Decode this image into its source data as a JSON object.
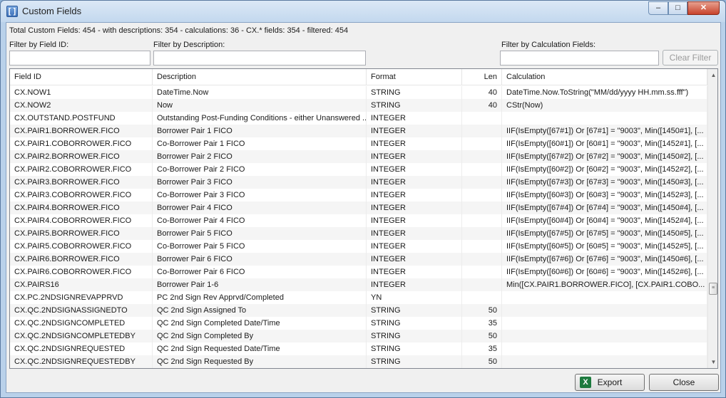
{
  "window": {
    "title": "Custom Fields",
    "app_icon_glyph": "[ ]",
    "minimize": "–",
    "maximize": "□",
    "close": "✕"
  },
  "summary": "Total Custom Fields: 454  -  with descriptions: 354  -  calculations: 36  -  CX.* fields: 354  -  filtered: 454",
  "filters": {
    "field_id_label": "Filter by Field ID:",
    "description_label": "Filter by Description:",
    "calculation_label": "Filter by Calculation Fields:",
    "field_id_value": "",
    "description_value": "",
    "calculation_value": "",
    "clear_label": "Clear Filter"
  },
  "columns": {
    "field_id": "Field ID",
    "description": "Description",
    "format": "Format",
    "len": "Len",
    "calculation": "Calculation"
  },
  "rows": [
    {
      "id": "CX.NOW1",
      "desc": "DateTime.Now",
      "fmt": "STRING",
      "len": "40",
      "calc": "DateTime.Now.ToString(\"MM/dd/yyyy HH.mm.ss.fff\")"
    },
    {
      "id": "CX.NOW2",
      "desc": "Now",
      "fmt": "STRING",
      "len": "40",
      "calc": "CStr(Now)"
    },
    {
      "id": "CX.OUTSTAND.POSTFUND",
      "desc": "Outstanding Post-Funding Conditions - either Unanswered ...",
      "fmt": "INTEGER",
      "len": "",
      "calc": ""
    },
    {
      "id": "CX.PAIR1.BORROWER.FICO",
      "desc": "Borrower Pair 1 FICO",
      "fmt": "INTEGER",
      "len": "",
      "calc": "IIF(IsEmpty([67#1]) Or [67#1] = \"9003\", Min([1450#1], [..."
    },
    {
      "id": "CX.PAIR1.COBORROWER.FICO",
      "desc": "Co-Borrower Pair 1 FICO",
      "fmt": "INTEGER",
      "len": "",
      "calc": "IIF(IsEmpty([60#1]) Or [60#1] = \"9003\", Min([1452#1], [..."
    },
    {
      "id": "CX.PAIR2.BORROWER.FICO",
      "desc": "Borrower Pair 2 FICO",
      "fmt": "INTEGER",
      "len": "",
      "calc": "IIF(IsEmpty([67#2]) Or [67#2] = \"9003\", Min([1450#2], [..."
    },
    {
      "id": "CX.PAIR2.COBORROWER.FICO",
      "desc": "Co-Borrower Pair 2 FICO",
      "fmt": "INTEGER",
      "len": "",
      "calc": "IIF(IsEmpty([60#2]) Or [60#2] = \"9003\", Min([1452#2], [..."
    },
    {
      "id": "CX.PAIR3.BORROWER.FICO",
      "desc": "Borrower Pair 3 FICO",
      "fmt": "INTEGER",
      "len": "",
      "calc": "IIF(IsEmpty([67#3]) Or [67#3] = \"9003\", Min([1450#3], [..."
    },
    {
      "id": "CX.PAIR3.COBORROWER.FICO",
      "desc": "Co-Borrower Pair 3 FICO",
      "fmt": "INTEGER",
      "len": "",
      "calc": "IIF(IsEmpty([60#3]) Or [60#3] = \"9003\", Min([1452#3], [..."
    },
    {
      "id": "CX.PAIR4.BORROWER.FICO",
      "desc": "Borrower Pair 4 FICO",
      "fmt": "INTEGER",
      "len": "",
      "calc": "IIF(IsEmpty([67#4]) Or [67#4] = \"9003\", Min([1450#4], [..."
    },
    {
      "id": "CX.PAIR4.COBORROWER.FICO",
      "desc": "Co-Borrower Pair 4 FICO",
      "fmt": "INTEGER",
      "len": "",
      "calc": "IIF(IsEmpty([60#4]) Or [60#4] = \"9003\", Min([1452#4], [..."
    },
    {
      "id": "CX.PAIR5.BORROWER.FICO",
      "desc": "Borrower Pair 5 FICO",
      "fmt": "INTEGER",
      "len": "",
      "calc": "IIF(IsEmpty([67#5]) Or [67#5] = \"9003\", Min([1450#5], [..."
    },
    {
      "id": "CX.PAIR5.COBORROWER.FICO",
      "desc": "Co-Borrower Pair 5 FICO",
      "fmt": "INTEGER",
      "len": "",
      "calc": "IIF(IsEmpty([60#5]) Or [60#5] = \"9003\", Min([1452#5], [..."
    },
    {
      "id": "CX.PAIR6.BORROWER.FICO",
      "desc": "Borrower Pair 6 FICO",
      "fmt": "INTEGER",
      "len": "",
      "calc": "IIF(IsEmpty([67#6]) Or [67#6] = \"9003\", Min([1450#6], [..."
    },
    {
      "id": "CX.PAIR6.COBORROWER.FICO",
      "desc": "Co-Borrower Pair 6 FICO",
      "fmt": "INTEGER",
      "len": "",
      "calc": "IIF(IsEmpty([60#6]) Or [60#6] = \"9003\", Min([1452#6], [..."
    },
    {
      "id": "CX.PAIRS16",
      "desc": "Borrower Pair 1-6",
      "fmt": "INTEGER",
      "len": "",
      "calc": "Min([CX.PAIR1.BORROWER.FICO], [CX.PAIR1.COBO..."
    },
    {
      "id": "CX.PC.2NDSIGNREVAPPRVD",
      "desc": "PC 2nd Sign Rev Apprvd/Completed",
      "fmt": "YN",
      "len": "",
      "calc": ""
    },
    {
      "id": "CX.QC.2NDSIGNASSIGNEDTO",
      "desc": "QC 2nd Sign Assigned To",
      "fmt": "STRING",
      "len": "50",
      "calc": ""
    },
    {
      "id": "CX.QC.2NDSIGNCOMPLETED",
      "desc": "QC 2nd Sign Completed Date/Time",
      "fmt": "STRING",
      "len": "35",
      "calc": ""
    },
    {
      "id": "CX.QC.2NDSIGNCOMPLETEDBY",
      "desc": "QC 2nd Sign Completed By",
      "fmt": "STRING",
      "len": "50",
      "calc": ""
    },
    {
      "id": "CX.QC.2NDSIGNREQUESTED",
      "desc": "QC 2nd Sign Requested Date/Time",
      "fmt": "STRING",
      "len": "35",
      "calc": ""
    },
    {
      "id": "CX.QC.2NDSIGNREQUESTEDBY",
      "desc": "QC 2nd Sign Requested By",
      "fmt": "STRING",
      "len": "50",
      "calc": ""
    }
  ],
  "scrollbar": {
    "up": "▲",
    "down": "▼",
    "thumb_grip": "≡"
  },
  "buttons": {
    "export_label": "Export",
    "excel_glyph": "X",
    "close_label": "Close"
  }
}
